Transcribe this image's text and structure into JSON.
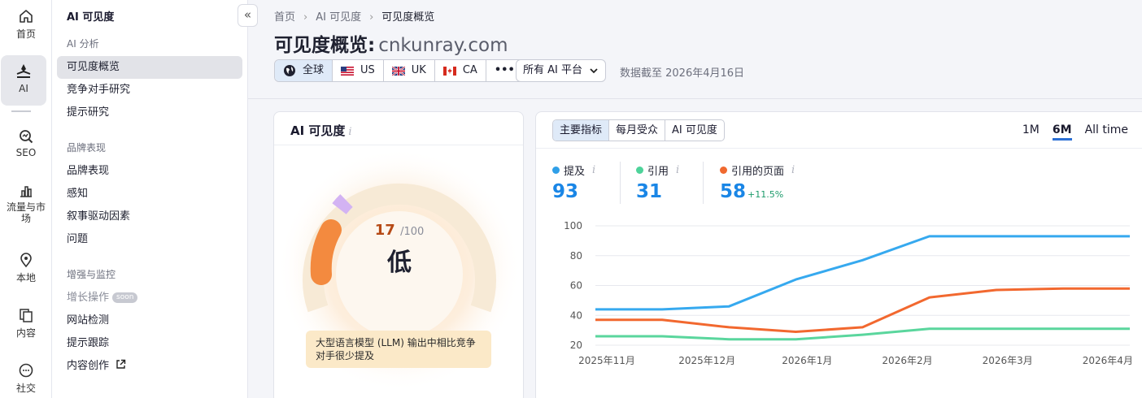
{
  "rail": {
    "items": [
      {
        "label": "首页",
        "icon": "home-icon"
      },
      {
        "label": "AI",
        "icon": "ai-icon"
      },
      {
        "label": "SEO",
        "icon": "seo-icon"
      },
      {
        "label": "流量与市场",
        "icon": "traffic-icon"
      },
      {
        "label": "本地",
        "icon": "location-icon"
      },
      {
        "label": "内容",
        "icon": "content-icon"
      },
      {
        "label": "社交",
        "icon": "chat-icon"
      }
    ]
  },
  "subnav": {
    "title": "AI 可见度",
    "group1": "AI 分析",
    "items1": [
      "可见度概览",
      "竞争对手研究",
      "提示研究"
    ],
    "group2": "品牌表现",
    "items2": [
      "品牌表现",
      "感知",
      "叙事驱动因素",
      "问题"
    ],
    "group3": "增强与监控",
    "growth": "增长操作",
    "soon": "soon",
    "items3": [
      "网站检测",
      "提示跟踪",
      "内容创作"
    ]
  },
  "breadcrumb": [
    "首页",
    "AI 可见度",
    "可见度概览"
  ],
  "page": {
    "title": "可见度概览:",
    "domain": "cnkunray.com"
  },
  "regions": [
    "全球",
    "US",
    "UK",
    "CA",
    "•••"
  ],
  "platform_select": "所有 AI 平台",
  "data_date": "数据截至 2026年4月16日",
  "visibility_card": {
    "title": "AI 可见度",
    "info": "i",
    "score": "17",
    "score_max": "/100",
    "score_value": 17,
    "level": "低",
    "tip": "大型语言模型 (LLM) 输出中相比竞争对手很少提及"
  },
  "chart_card": {
    "tabs": [
      "主要指标",
      "每月受众",
      "AI 可见度"
    ],
    "ranges": [
      "1M",
      "6M",
      "All time"
    ],
    "metrics": [
      {
        "label": "提及",
        "value": "93",
        "color": "#2f9fe8"
      },
      {
        "label": "引用",
        "value": "31",
        "color": "#4ed39a"
      },
      {
        "label": "引用的页面",
        "value": "58",
        "change": "+11.5%",
        "color": "#f0692f"
      }
    ]
  },
  "chart_data": {
    "type": "line",
    "x": [
      "2025年11月",
      "2025年12月",
      "2026年1月",
      "2026年2月",
      "2026年3月",
      "2026年4月"
    ],
    "ylim": [
      20,
      100
    ],
    "yticks": [
      20,
      40,
      60,
      80,
      100
    ],
    "grid": true,
    "series": [
      {
        "name": "提及",
        "color": "#36a9ef",
        "points": [
          [
            0,
            44
          ],
          [
            0.5,
            44
          ],
          [
            1,
            46
          ],
          [
            1.5,
            64
          ],
          [
            2,
            77
          ],
          [
            2.5,
            93
          ],
          [
            3,
            93
          ],
          [
            3.5,
            93
          ],
          [
            4,
            93
          ]
        ]
      },
      {
        "name": "引用",
        "color": "#5ad69d",
        "points": [
          [
            0,
            26
          ],
          [
            0.5,
            26
          ],
          [
            1,
            24
          ],
          [
            1.5,
            24
          ],
          [
            2,
            27
          ],
          [
            2.5,
            31
          ],
          [
            3,
            31
          ],
          [
            3.5,
            31
          ],
          [
            4,
            31
          ]
        ]
      },
      {
        "name": "引用的页面",
        "color": "#f2682f",
        "points": [
          [
            0,
            37
          ],
          [
            0.5,
            37
          ],
          [
            1,
            32
          ],
          [
            1.5,
            29
          ],
          [
            2,
            32
          ],
          [
            2.5,
            52
          ],
          [
            3,
            57
          ],
          [
            3.5,
            58
          ],
          [
            4,
            58
          ]
        ]
      }
    ]
  }
}
